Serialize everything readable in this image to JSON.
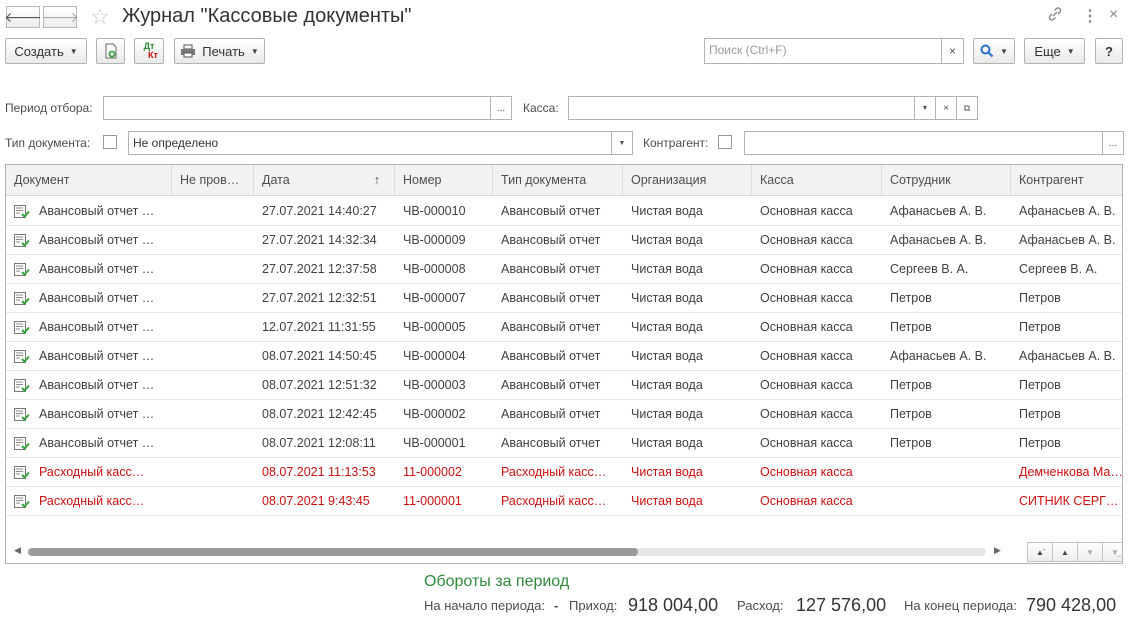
{
  "window": {
    "title": "Журнал \"Кассовые документы\"",
    "back_icon": "arrow-left-icon",
    "forward_icon": "arrow-right-icon",
    "favorite_icon": "star-icon",
    "link_icon": "link-icon",
    "more_icon": "more-vertical-icon",
    "close_icon": "close-icon"
  },
  "toolbar": {
    "create_label": "Создать",
    "print_label": "Печать",
    "search_placeholder": "Поиск (Ctrl+F)",
    "search_clear": "×",
    "more_label": "Еще",
    "help_label": "?",
    "dtkt_top": "Дт",
    "dtkt_bottom": "Кт"
  },
  "filters": {
    "period_label": "Период отбора:",
    "period_value": "",
    "period_select": "...",
    "kassa_label": "Касса:",
    "kassa_value": "",
    "doc_type_label": "Тип документа:",
    "doc_type_value": "Не определено",
    "contragent_label": "Контрагент:",
    "contragent_value": "",
    "contragent_select": "..."
  },
  "table": {
    "columns": [
      "Документ",
      "Не пров…",
      "Дата",
      "Номер",
      "Тип документа",
      "Организация",
      "Касса",
      "Сотрудник",
      "Контрагент"
    ],
    "sort_indicator": "↑",
    "rows": [
      {
        "doc": "Авансовый отчет …",
        "np": "",
        "date": "27.07.2021 14:40:27",
        "num": "ЧВ-000010",
        "type": "Авансовый отчет",
        "org": "Чистая вода",
        "kassa": "Основная касса",
        "emp": "Афанасьев А. В.",
        "contr": "Афанасьев А. В.",
        "red": false
      },
      {
        "doc": "Авансовый отчет …",
        "np": "",
        "date": "27.07.2021 14:32:34",
        "num": "ЧВ-000009",
        "type": "Авансовый отчет",
        "org": "Чистая вода",
        "kassa": "Основная касса",
        "emp": "Афанасьев А. В.",
        "contr": "Афанасьев А. В.",
        "red": false
      },
      {
        "doc": "Авансовый отчет …",
        "np": "",
        "date": "27.07.2021 12:37:58",
        "num": "ЧВ-000008",
        "type": "Авансовый отчет",
        "org": "Чистая вода",
        "kassa": "Основная касса",
        "emp": "Сергеев В. А.",
        "contr": "Сергеев В. А.",
        "red": false
      },
      {
        "doc": "Авансовый отчет …",
        "np": "",
        "date": "27.07.2021 12:32:51",
        "num": "ЧВ-000007",
        "type": "Авансовый отчет",
        "org": "Чистая вода",
        "kassa": "Основная касса",
        "emp": "Петров",
        "contr": "Петров",
        "red": false
      },
      {
        "doc": "Авансовый отчет …",
        "np": "",
        "date": "12.07.2021 11:31:55",
        "num": "ЧВ-000005",
        "type": "Авансовый отчет",
        "org": "Чистая вода",
        "kassa": "Основная касса",
        "emp": "Петров",
        "contr": "Петров",
        "red": false
      },
      {
        "doc": "Авансовый отчет …",
        "np": "",
        "date": "08.07.2021 14:50:45",
        "num": "ЧВ-000004",
        "type": "Авансовый отчет",
        "org": "Чистая вода",
        "kassa": "Основная касса",
        "emp": "Афанасьев А. В.",
        "contr": "Афанасьев А. В.",
        "red": false
      },
      {
        "doc": "Авансовый отчет …",
        "np": "",
        "date": "08.07.2021 12:51:32",
        "num": "ЧВ-000003",
        "type": "Авансовый отчет",
        "org": "Чистая вода",
        "kassa": "Основная касса",
        "emp": "Петров",
        "contr": "Петров",
        "red": false
      },
      {
        "doc": "Авансовый отчет …",
        "np": "",
        "date": "08.07.2021 12:42:45",
        "num": "ЧВ-000002",
        "type": "Авансовый отчет",
        "org": "Чистая вода",
        "kassa": "Основная касса",
        "emp": "Петров",
        "contr": "Петров",
        "red": false
      },
      {
        "doc": "Авансовый отчет …",
        "np": "",
        "date": "08.07.2021 12:08:11",
        "num": "ЧВ-000001",
        "type": "Авансовый отчет",
        "org": "Чистая вода",
        "kassa": "Основная касса",
        "emp": "Петров",
        "contr": "Петров",
        "red": false
      },
      {
        "doc": "Расходный касс…",
        "np": "",
        "date": "08.07.2021 11:13:53",
        "num": "11-000002",
        "type": "Расходный касс…",
        "org": "Чистая вода",
        "kassa": "Основная касса",
        "emp": "",
        "contr": "Демченкова Ма…",
        "red": true
      },
      {
        "doc": "Расходный касс…",
        "np": "",
        "date": "08.07.2021 9:43:45",
        "num": "11-000001",
        "type": "Расходный касс…",
        "org": "Чистая вода",
        "kassa": "Основная касса",
        "emp": "",
        "contr": "СИТНИК СЕРГЕ…",
        "red": true
      }
    ]
  },
  "colors": {
    "red_row": "#d01010",
    "footer_title": "#2e8b3a",
    "doc_icon_green": "#3aa141"
  },
  "footer": {
    "title": "Обороты за период",
    "start_label": "На начало периода:",
    "start_value": "-",
    "income_label": "Приход:",
    "income_value": "918 004,00",
    "expense_label": "Расход:",
    "expense_value": "127 576,00",
    "end_label": "На конец периода:",
    "end_value": "790 428,00"
  }
}
